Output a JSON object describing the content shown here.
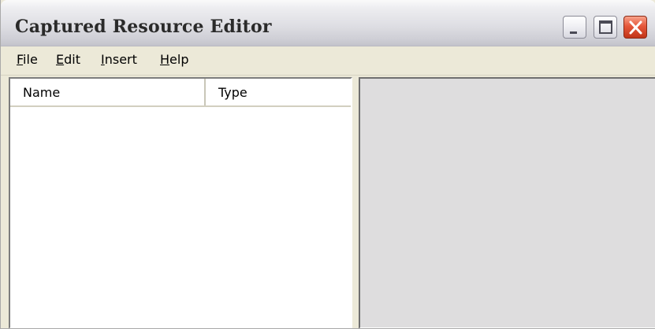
{
  "window": {
    "title": "Captured Resource Editor",
    "controls": {
      "minimize_icon": "minimize-icon",
      "maximize_icon": "maximize-icon",
      "close_icon": "close-icon"
    }
  },
  "menu": {
    "items": [
      {
        "mnemonic": "F",
        "rest": "ile"
      },
      {
        "mnemonic": "E",
        "rest": "dit"
      },
      {
        "mnemonic": "I",
        "rest": "nsert"
      },
      {
        "mnemonic": "H",
        "rest": "elp"
      }
    ]
  },
  "resource_list": {
    "columns": [
      {
        "label": "Name"
      },
      {
        "label": "Type"
      }
    ],
    "rows": []
  },
  "colors": {
    "window_face": "#ece9d8",
    "preview_background": "#deddde",
    "close_button": "#e5573a"
  }
}
